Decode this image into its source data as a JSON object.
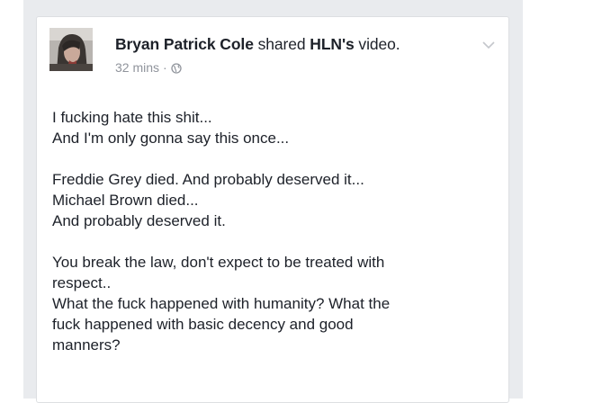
{
  "post": {
    "author": "Bryan Patrick Cole",
    "shared_text": "shared",
    "shared_page": "HLN's",
    "shared_object": "video.",
    "timestamp": "32 mins",
    "separator": "·",
    "privacy_icon": "globe-icon",
    "menu_icon": "chevron-down-icon",
    "paragraphs": [
      [
        "I fucking hate this shit...",
        "And I'm only gonna say this once..."
      ],
      [
        "Freddie Grey died.  And probably deserved it...",
        "Michael Brown died...",
        "And probably deserved it."
      ],
      [
        "You break the law, don't expect to be treated with",
        "respect..",
        "What the fuck happened with humanity?  What the",
        "fuck happened with basic decency and good",
        "manners?"
      ]
    ]
  },
  "colors": {
    "page_background": "#e9ebee",
    "card_background": "#ffffff",
    "text": "#1d2129",
    "meta_text": "#90949c"
  }
}
